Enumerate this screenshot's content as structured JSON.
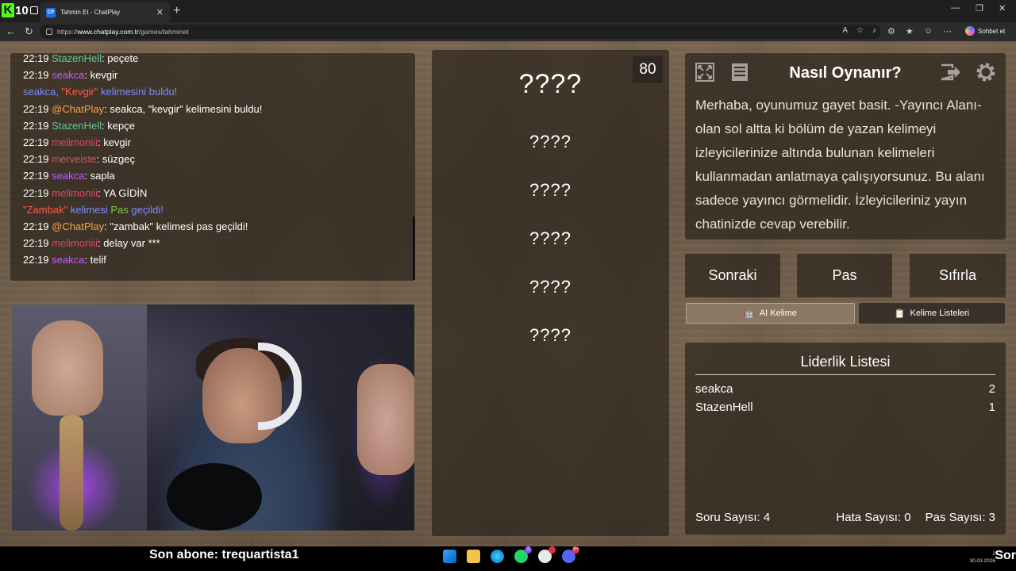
{
  "browser": {
    "overlay_counter": "10",
    "tab_title": "Tahmin Et - ChatPlay",
    "tab_favicon": "CP",
    "url_prefix": "https://",
    "url_host": "www.chatplay.com.tr",
    "url_path": "/games/tahminet",
    "copilot_label": "Sohbet et"
  },
  "chat": {
    "messages": [
      {
        "time": "22:19",
        "user": "StazenHell",
        "text": "peçete"
      },
      {
        "time": "22:19",
        "user": "seakca",
        "text": "kevgir"
      },
      {
        "system_a": "seakca, ",
        "system_b": "\"Kevgir\"",
        "system_c": " kelimesini buldu!"
      },
      {
        "time": "22:19",
        "user": "@ChatPlay",
        "text": "seakca, \"kevgir\" kelimesini buldu!"
      },
      {
        "time": "22:19",
        "user": "StazenHell",
        "text": "kepçe"
      },
      {
        "time": "22:19",
        "user": "melimoniii",
        "text": "kevgir"
      },
      {
        "time": "22:19",
        "user": "merveiste",
        "text": "süzgeç"
      },
      {
        "time": "22:19",
        "user": "seakca",
        "text": "sapla"
      },
      {
        "time": "22:19",
        "user": "melimoniii",
        "text": "YA GİDİN"
      },
      {
        "system_a": "\"Zambak\"",
        "system_b": " kelimesi ",
        "system_c": "Pas",
        "system_d": " geçildi!"
      },
      {
        "time": "22:19",
        "user": "@ChatPlay",
        "text": "\"zambak\" kelimesi pas geçildi!"
      },
      {
        "time": "22:19",
        "user": "melimoniii",
        "text": "delay var ***"
      },
      {
        "time": "22:19",
        "user": "seakca",
        "text": "telif"
      }
    ]
  },
  "game": {
    "timer": "80",
    "current_word": "????",
    "words": [
      "????",
      "????",
      "????",
      "????",
      "????"
    ]
  },
  "howto": {
    "title": "Nasıl Oynanır?",
    "text": "Merhaba, oyunumuz gayet basit. -Yayıncı Alanı- olan sol altta ki bölüm de yazan kelimeyi izleyicilerinize altında bulunan kelimeleri kullanmadan anlatmaya çalışıyorsunuz. Bu alanı sadece yayıncı görmelidir. İzleyicileriniz yayın chatinizde cevap verebilir."
  },
  "actions": {
    "next": "Sonraki",
    "pass": "Pas",
    "reset": "Sıfırla",
    "ai_word": "AI Kelime",
    "word_lists": "Kelime Listeleri"
  },
  "leaderboard": {
    "title": "Liderlik Listesi",
    "rows": [
      {
        "name": "seakca",
        "score": "2"
      },
      {
        "name": "StazenHell",
        "score": "1"
      }
    ],
    "question_count": "Soru Sayısı: 4",
    "error_count": "Hata Sayısı: 0",
    "pass_count": "Pas Sayısı: 3"
  },
  "overlay": {
    "last_sub": "Son abone: trequartista1",
    "corner_text": "Sor"
  },
  "taskbar": {
    "edge_badge": "2",
    "app_badge": "9+",
    "clock_time": "2",
    "clock_date": "30.03.2026"
  }
}
